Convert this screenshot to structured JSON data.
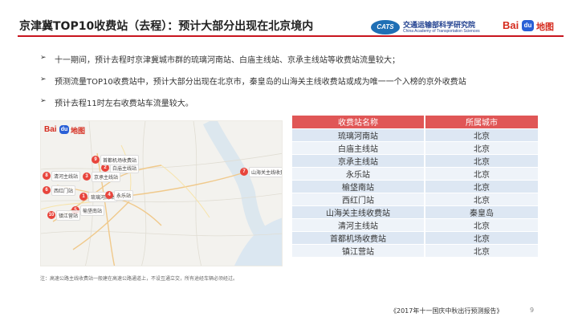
{
  "header": {
    "title": "京津冀TOP10收费站（去程）：预计大部分出现在北京境内",
    "cats_mark": "CATS",
    "cats_name_cn": "交通运输部科学研究院",
    "cats_name_en": "China Academy of Transportation Sciences",
    "baidu_text": "Bai",
    "baidu_paw": "du",
    "baidu_map": "地图"
  },
  "bullets": [
    "十一期间，预计去程时京津冀城市群的琉璃河南站、白庙主线站、京承主线站等收费站流量较大；",
    "预测流量TOP10收费站中，预计大部分出现在北京市，秦皇岛的山海关主线收费站或成为唯一一个入榜的京外收费站",
    "预计去程11时左右收费站车流量较大。"
  ],
  "bullet_glyph": "➢",
  "map": {
    "baidu_text": "Bai",
    "baidu_paw": "du",
    "baidu_map": "地图",
    "pins": [
      {
        "num": "1",
        "label": "琉璃河南站"
      },
      {
        "num": "2",
        "label": "白庙主线站"
      },
      {
        "num": "3",
        "label": "京承主线站"
      },
      {
        "num": "4",
        "label": "永乐站"
      },
      {
        "num": "5",
        "label": "榆垡南站"
      },
      {
        "num": "6",
        "label": "西红门站"
      },
      {
        "num": "7",
        "label": "山海关主线收费站"
      },
      {
        "num": "8",
        "label": "清河主线站"
      },
      {
        "num": "9",
        "label": "首都机场收费站"
      },
      {
        "num": "10",
        "label": "镇江营站"
      }
    ]
  },
  "table": {
    "headers": [
      "收费站名称",
      "所属城市"
    ],
    "rows": [
      [
        "琉璃河南站",
        "北京"
      ],
      [
        "白庙主线站",
        "北京"
      ],
      [
        "京承主线站",
        "北京"
      ],
      [
        "永乐站",
        "北京"
      ],
      [
        "榆垡南站",
        "北京"
      ],
      [
        "西红门站",
        "北京"
      ],
      [
        "山海关主线收费站",
        "秦皇岛"
      ],
      [
        "清河主线站",
        "北京"
      ],
      [
        "首都机场收费站",
        "北京"
      ],
      [
        "镇江营站",
        "北京"
      ]
    ]
  },
  "note": "注：高速公路主线收费站一般建在高速公路通道上，不设互通立交，所有途经车辆必须经过。",
  "footer": "《2017年十一国庆中秋出行预测报告》",
  "page_number": "9",
  "colors": {
    "accent_red": "#c8141e",
    "table_header": "#e05656",
    "pin": "#e8453c",
    "cats_blue": "#1f6fb5"
  }
}
